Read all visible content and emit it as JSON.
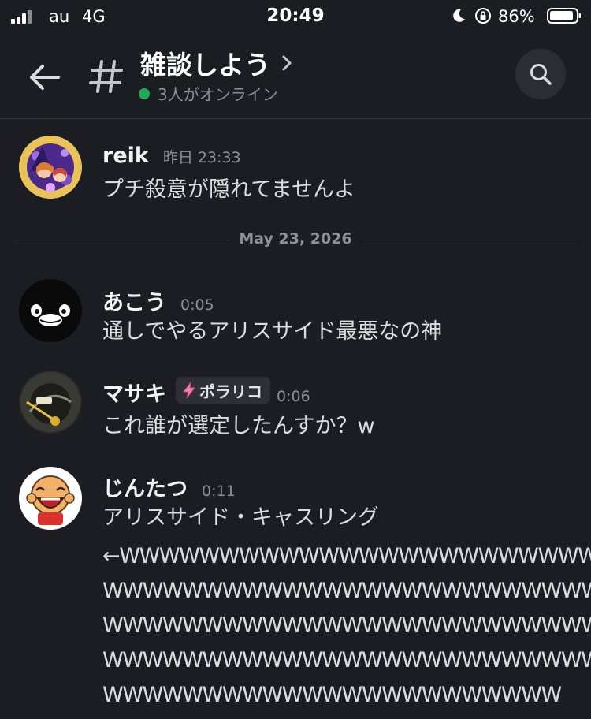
{
  "status_bar": {
    "carrier": "au",
    "network": "4G",
    "time": "20:49",
    "battery_percent": "86%",
    "icons": [
      "signal-icon",
      "moon-icon",
      "rotation-lock-icon",
      "battery-icon"
    ]
  },
  "header": {
    "channel_name": "雑談しよう",
    "online_status": "3人がオンライン",
    "icons": [
      "back-arrow-icon",
      "hash-icon",
      "chevron-right-icon",
      "search-icon"
    ]
  },
  "colors": {
    "background": "#1c1d22",
    "online": "#23a55a",
    "tag_bolt": "#f47fb4"
  },
  "date_separator": "May 23, 2026",
  "messages": [
    {
      "author": "reik",
      "time": "昨日 23:33",
      "text": "プチ殺意が隠れてませんよ"
    },
    {
      "author": "あこう",
      "time": "0:05",
      "text": "通しでやるアリスサイド最悪なの神"
    },
    {
      "author": "マサキ",
      "tag": "ポラリコ",
      "time": "0:06",
      "text": "これ誰が選定したんすか？w"
    },
    {
      "author": "じんたつ",
      "time": "0:11",
      "text": "アリスサイド・キャスリング",
      "followup_lines": [
        "←WWWWWWWWWWWWWWWWWWWWWWWWW",
        "WWWWWWWWWWWWWWWWWWWWWWWWW",
        "WWWWWWWWWWWWWWWWWWWWWWWWW",
        "WWWWWWWWWWWWWWWWWWWWWWWWW",
        "WWWWWWWWWWWWWWWWWWWWWWW"
      ]
    }
  ]
}
